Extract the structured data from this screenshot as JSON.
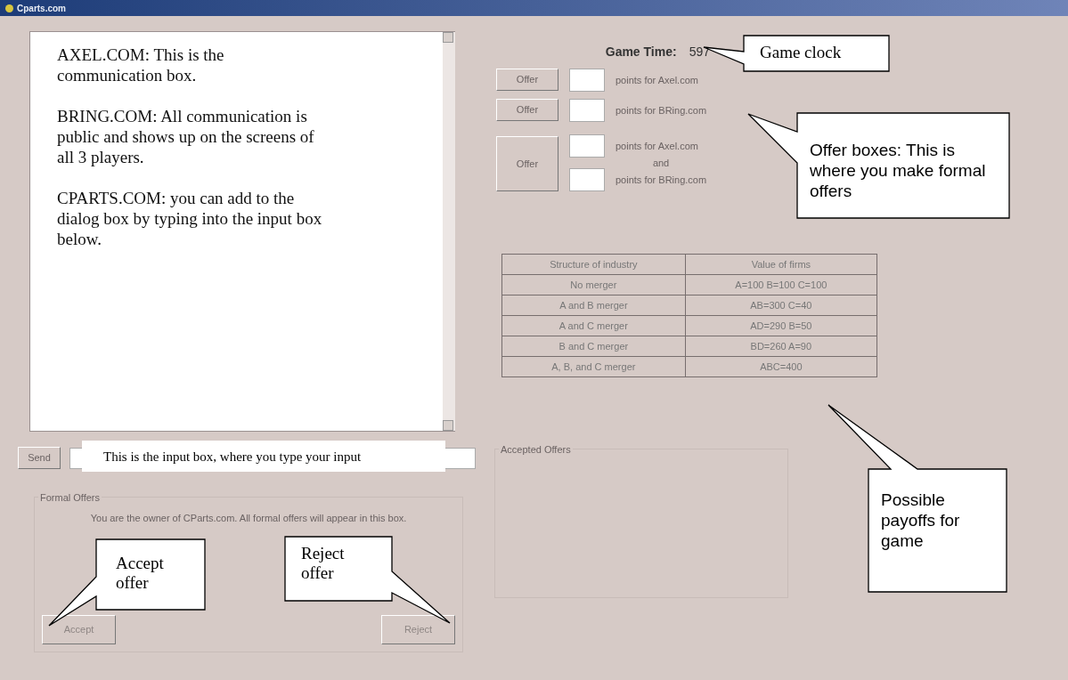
{
  "window": {
    "title": "Cparts.com"
  },
  "chat": {
    "messages": [
      "AXEL.COM: This is the communication box.",
      "BRING.COM: All communication is public and shows up on the screens of all 3 players.",
      "CPARTS.COM: you can add to the dialog box by typing into the input box below."
    ]
  },
  "send": {
    "button": "Send"
  },
  "game_time": {
    "label": "Game Time:",
    "value": "597"
  },
  "offers": [
    {
      "kind": "single",
      "button": "Offer",
      "labels": [
        "points for Axel.com"
      ]
    },
    {
      "kind": "single",
      "button": "Offer",
      "labels": [
        "points for BRing.com"
      ]
    },
    {
      "kind": "double",
      "button": "Offer",
      "labels": [
        "points for Axel.com",
        "and",
        "points for BRing.com"
      ]
    }
  ],
  "payoff_table": {
    "columns": [
      "Structure of industry",
      "Value of firms"
    ],
    "rows": [
      [
        "No merger",
        "A=100  B=100  C=100"
      ],
      [
        "A and B merger",
        "AB=300  C=40"
      ],
      [
        "A and C merger",
        "AD=290  B=50"
      ],
      [
        "B and C merger",
        "BD=260  A=90"
      ],
      [
        "A, B, and C merger",
        "ABC=400"
      ]
    ]
  },
  "formal_offers": {
    "title": "Formal Offers",
    "message": "You are the owner of CParts.com. All formal offers will appear in this box.",
    "accept": {
      "label": "Accept",
      "disabled": true
    },
    "reject": {
      "label": "Reject",
      "disabled": true
    }
  },
  "accepted_offers": {
    "title": "Accepted Offers"
  },
  "callouts": [
    {
      "text": "Game clock"
    },
    {
      "text": "Offer boxes: This is where you make formal offers"
    },
    {
      "text": "Possible payoffs for game"
    },
    {
      "text": "This is the input box, where you type your input"
    },
    {
      "text": "Accept offer"
    },
    {
      "text": "Reject offer"
    }
  ]
}
